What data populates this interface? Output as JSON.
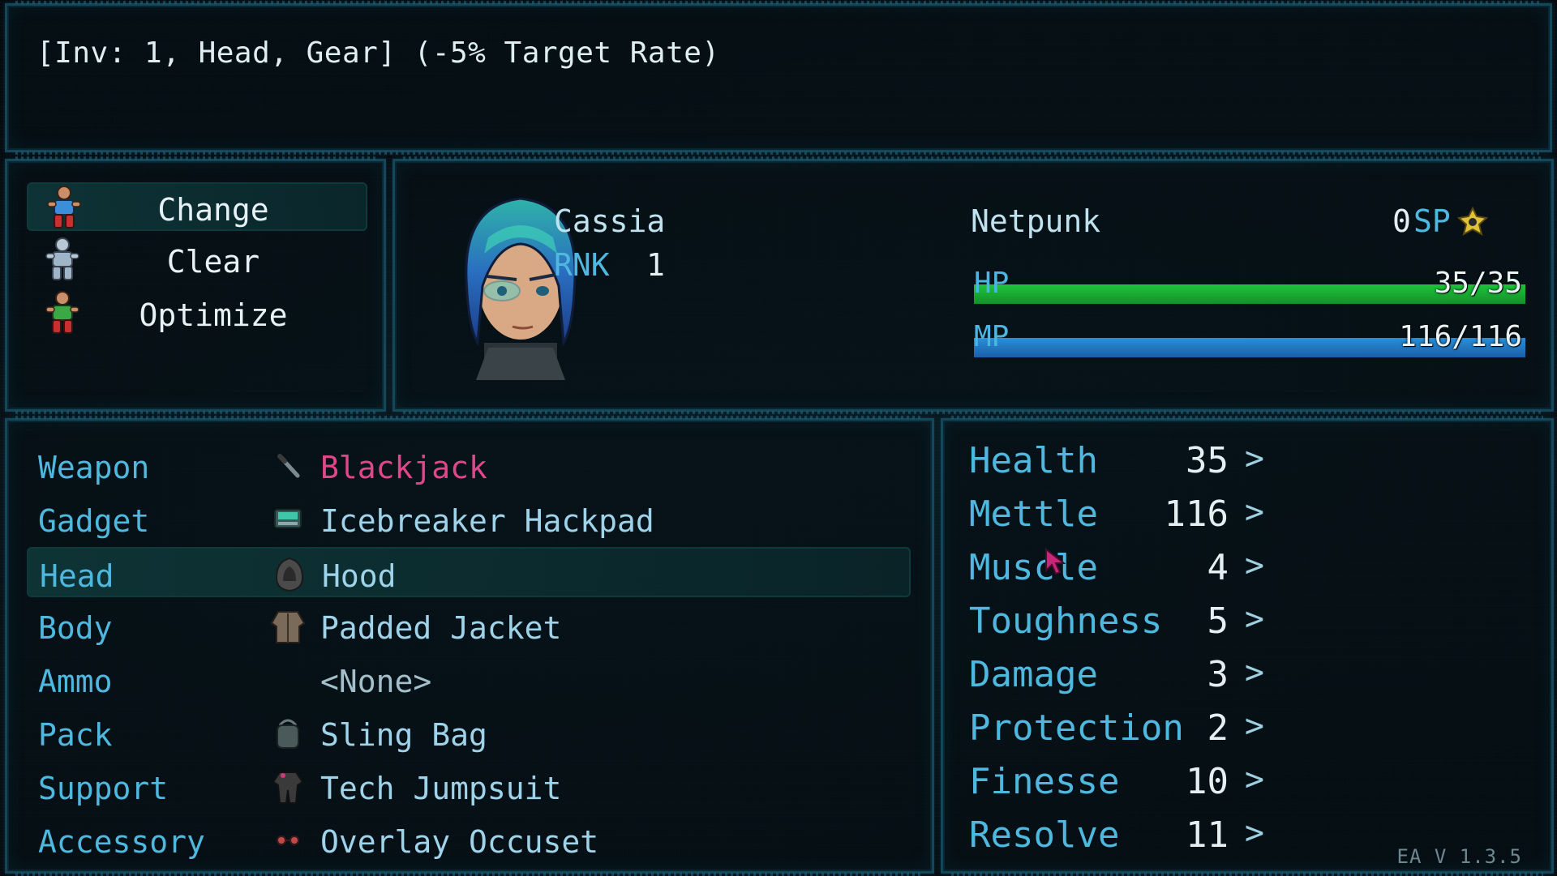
{
  "help": {
    "text": "[Inv: 1, Head, Gear] (-5% Target Rate)"
  },
  "commands": {
    "items": [
      {
        "label": "Change",
        "icon": "figure-blue-icon",
        "selected": true
      },
      {
        "label": "Clear",
        "icon": "figure-grey-icon",
        "selected": false
      },
      {
        "label": "Optimize",
        "icon": "figure-green-icon",
        "selected": false
      }
    ]
  },
  "actor": {
    "name": "Cassia",
    "rank_label": "RNK",
    "rank": "1",
    "class": "Netpunk",
    "sp": "0",
    "sp_label": "SP",
    "hp_label": "HP",
    "hp_value": "35/35",
    "hp_fraction": 1.0,
    "mp_label": "MP",
    "mp_value": "116/116",
    "mp_fraction": 1.0,
    "colors": {
      "hp": "#1fc43a",
      "mp": "#2a8fd8"
    }
  },
  "slots": [
    {
      "label": "Weapon",
      "item": "Blackjack",
      "icon": "baton-icon"
    },
    {
      "label": "Gadget",
      "item": "Icebreaker Hackpad",
      "icon": "hackpad-icon"
    },
    {
      "label": "Head",
      "item": "Hood",
      "icon": "hood-icon",
      "selected": true
    },
    {
      "label": "Body",
      "item": "Padded Jacket",
      "icon": "jacket-icon"
    },
    {
      "label": "Ammo",
      "item": "<None>",
      "icon": ""
    },
    {
      "label": "Pack",
      "item": "Sling Bag",
      "icon": "bag-icon"
    },
    {
      "label": "Support",
      "item": "Tech Jumpsuit",
      "icon": "jumpsuit-icon"
    },
    {
      "label": "Accessory",
      "item": "Overlay Occuset",
      "icon": "glasses-icon"
    }
  ],
  "stats": [
    {
      "name": "Health",
      "value": "35"
    },
    {
      "name": "Mettle",
      "value": "116"
    },
    {
      "name": "Muscle",
      "value": "4"
    },
    {
      "name": "Toughness",
      "value": "5"
    },
    {
      "name": "Damage",
      "value": "3"
    },
    {
      "name": "Protection",
      "value": "2"
    },
    {
      "name": "Finesse",
      "value": "10"
    },
    {
      "name": "Resolve",
      "value": "11"
    }
  ],
  "stat_arrow": ">",
  "version": "EA V 1.3.5"
}
